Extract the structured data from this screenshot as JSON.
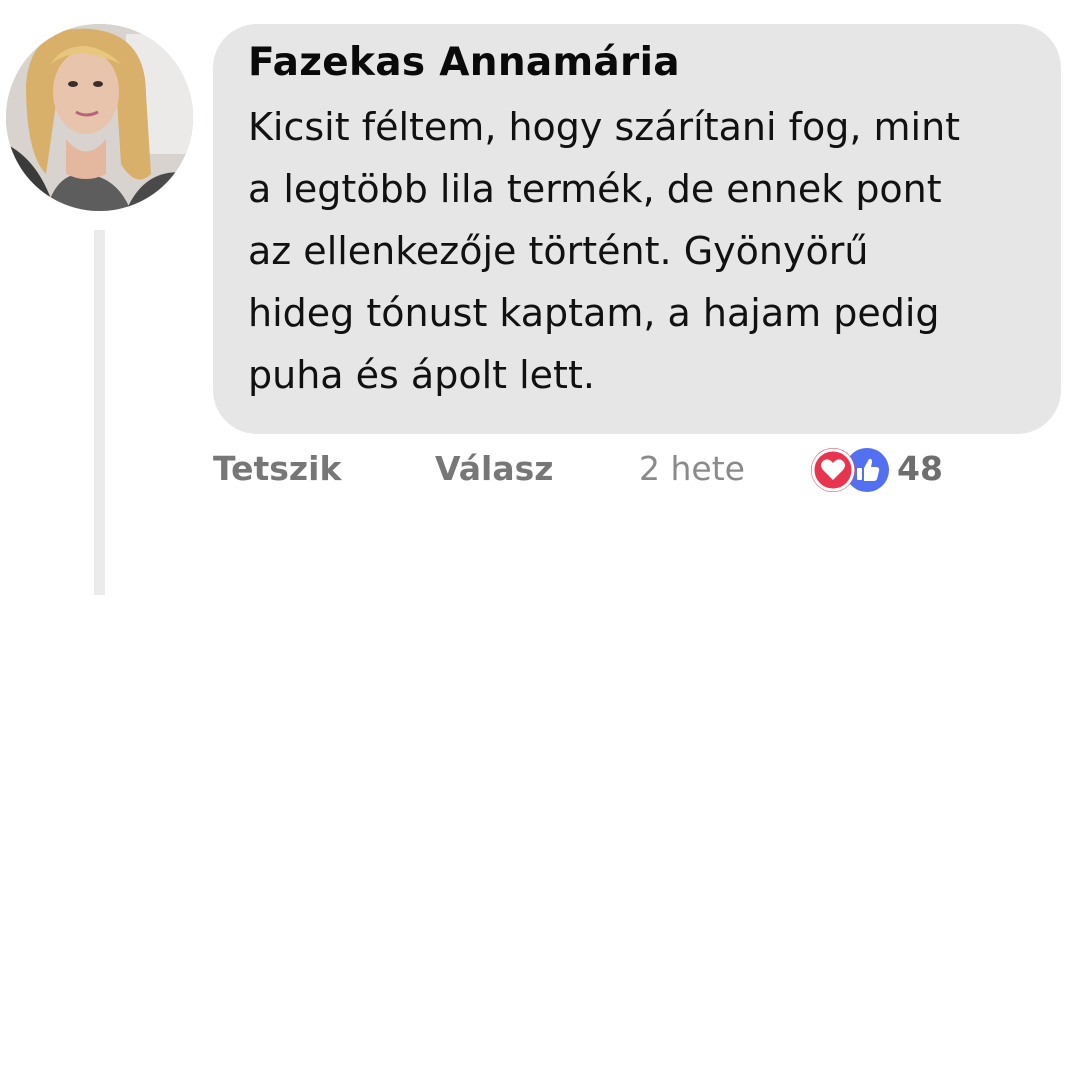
{
  "comment": {
    "author": "Fazekas Annamária",
    "text_lines": [
      "Kicsit féltem, hogy szárítani fog, mint",
      "a legtöbb lila termék, de ennek pont",
      "az ellenkezője történt. Gyönyörű",
      "hideg tónust kaptam, a hajam pedig",
      "puha és ápolt lett."
    ]
  },
  "actions": {
    "like_label": "Tetszik",
    "reply_label": "Válasz",
    "time_ago": "2 hete"
  },
  "reactions": {
    "icons": [
      "heart-icon",
      "thumbs-up-icon"
    ],
    "count": "48",
    "colors": {
      "love": "#e8344f",
      "like": "#5270f0"
    }
  },
  "colors": {
    "bubble": "#e6e6e6",
    "thread_line": "#ebebeb",
    "action_text": "#777777"
  }
}
